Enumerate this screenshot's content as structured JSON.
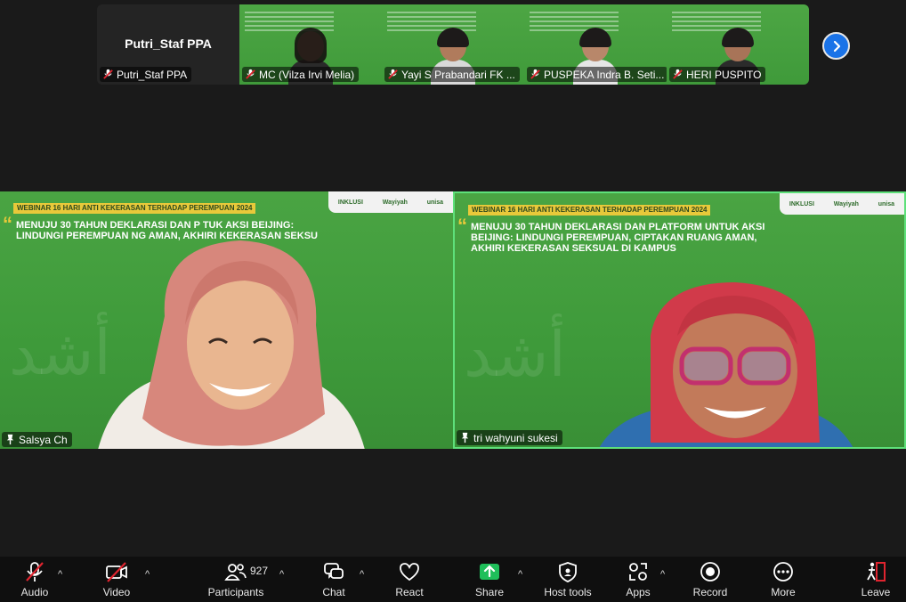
{
  "filmstrip": {
    "tiles": [
      {
        "big_name": "Putri_Staf PPA",
        "name": "Putri_Staf PPA"
      },
      {
        "name": "MC (Vilza Irvi Melia)"
      },
      {
        "name": "Yayi S Prabandari FK ..."
      },
      {
        "name": "PUSPEKA Indra B. Seti..."
      },
      {
        "name": "HERI PUSPITO"
      }
    ],
    "next_icon": "chevron-right-icon"
  },
  "slide": {
    "banner": "WEBINAR 16 HARI ANTI KEKERASAN TERHADAP PEREMPUAN 2024",
    "title": "MENUJU 30 TAHUN DEKLARASI DAN PLATFORM UNTUK AKSI BEIJING: LINDUNGI PEREMPUAN, CIPTAKAN RUANG AMAN, AKHIRI KEKERASAN SEKSUAL DI KAMPUS",
    "title_left": "MENUJU 30 TAHUN DEKLARASI DAN P            TUK AKSI BEIJING: LINDUNGI PEREMPUAN            NG AMAN, AKHIRI KEKERASAN SEKSU",
    "logos": [
      "INKLUSI",
      "Wayiyah",
      "unisa"
    ]
  },
  "main": {
    "left_name": "Salsya Ch",
    "right_name": "tri wahyuni sukesi"
  },
  "toolbar": {
    "audio": "Audio",
    "video": "Video",
    "participants": "Participants",
    "participants_count": "927",
    "chat": "Chat",
    "react": "React",
    "share": "Share",
    "host_tools": "Host tools",
    "apps": "Apps",
    "record": "Record",
    "more": "More",
    "leave": "Leave"
  },
  "colors": {
    "slide_green": "#4aa443",
    "banner_yellow": "#e8c93a",
    "share_green": "#1fbf5a",
    "leave_red": "#e0242f",
    "active_speaker_border": "#5ee07a",
    "next_button_blue": "#1a73e8"
  }
}
